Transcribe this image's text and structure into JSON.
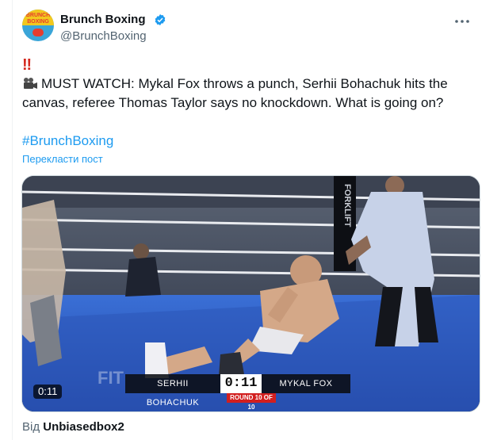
{
  "author": {
    "name": "Brunch Boxing",
    "handle": "@BrunchBoxing",
    "avatar_text": "BRUNCH BOXING",
    "verified_icon": "verified-badge-icon"
  },
  "tweet": {
    "alarm": "‼",
    "camera_icon": "movie-camera-icon",
    "text": "MUST WATCH: Mykal Fox throws a punch, Serhii Bohachuk hits the canvas, referee Thomas Taylor says no knockdown. What is going on?",
    "hashtag": "#BrunchBoxing",
    "translate": "Перекласти пост"
  },
  "video": {
    "duration": "0:11",
    "score_left": "SERHII BOHACHUK",
    "score_time": "0:11",
    "score_right": "MYKAL FOX",
    "round": "ROUND 10 OF 10",
    "ring_sign": "FORKLIFT"
  },
  "attribution": {
    "prefix": "Від",
    "source": "Unbiasedbox2"
  },
  "colors": {
    "link": "#1d9bf0",
    "muted": "#536471",
    "alarm": "#d4281e",
    "canvas_blue": "#2f5fc7"
  }
}
